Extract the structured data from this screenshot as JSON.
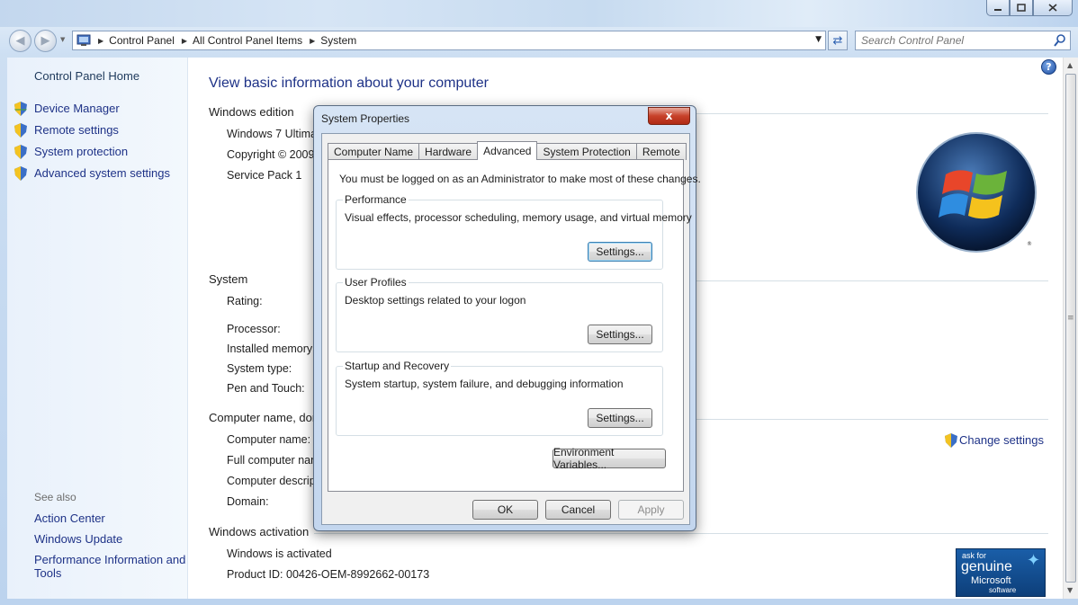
{
  "nav": {
    "breadcrumbs": [
      "Control Panel",
      "All Control Panel Items",
      "System"
    ],
    "search_placeholder": "Search Control Panel"
  },
  "left_pane": {
    "home": "Control Panel Home",
    "tasks": [
      "Device Manager",
      "Remote settings",
      "System protection",
      "Advanced system settings"
    ],
    "see_also_label": "See also",
    "see_also": [
      "Action Center",
      "Windows Update",
      "Performance Information and",
      "Tools"
    ]
  },
  "main": {
    "title": "View basic information about your computer",
    "windows_edition": {
      "heading": "Windows edition",
      "rows": [
        "Windows 7 Ultima",
        "Copyright © 2009",
        "Service Pack 1"
      ]
    },
    "system": {
      "heading": "System",
      "rows": [
        "Rating:",
        "Processor:",
        "Installed memory",
        "System type:",
        "Pen and Touch:"
      ]
    },
    "computer_name": {
      "heading": "Computer name, dom",
      "rows": [
        "Computer name:",
        "Full computer nan",
        "Computer descrip",
        "Domain:"
      ],
      "change_settings": "Change settings"
    },
    "activation": {
      "heading": "Windows activation",
      "status": "Windows is activated",
      "product_id": "Product ID:  00426-OEM-8992662-00173"
    },
    "genuine": {
      "line1": "ask for",
      "line2": "genuine",
      "line3": "Microsoft",
      "line4": "software"
    }
  },
  "dialog": {
    "title": "System Properties",
    "close": "x",
    "tabs": [
      "Computer Name",
      "Hardware",
      "Advanced",
      "System Protection",
      "Remote"
    ],
    "active_tab": "Advanced",
    "note": "You must be logged on as an Administrator to make most of these changes.",
    "groups": [
      {
        "title": "Performance",
        "desc": "Visual effects, processor scheduling, memory usage, and virtual memory",
        "button": "Settings..."
      },
      {
        "title": "User Profiles",
        "desc": "Desktop settings related to your logon",
        "button": "Settings..."
      },
      {
        "title": "Startup and Recovery",
        "desc": "System startup, system failure, and debugging information",
        "button": "Settings..."
      }
    ],
    "env_button": "Environment Variables...",
    "ok": "OK",
    "cancel": "Cancel",
    "apply": "Apply"
  },
  "colors": {
    "link": "#1e3287",
    "dialog_frame": "#c3d6ee",
    "close_red": "#c7412a"
  }
}
